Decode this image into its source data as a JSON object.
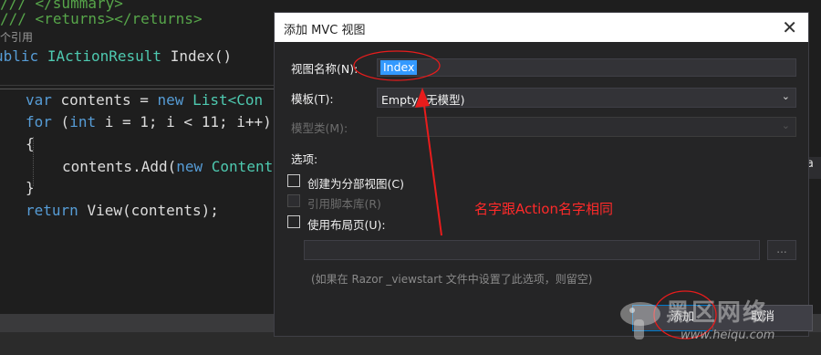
{
  "editor": {
    "line_summary": "/// </summary>",
    "line_returns_a": "///",
    "line_returns_b": "<returns></returns>",
    "ref_count": "个引用",
    "line_sig_a": "ublic",
    "line_sig_b": "IActionResult",
    "line_sig_c": "Index()",
    "line_var_a": "var",
    "line_var_b": "contents =",
    "line_var_c": "new",
    "line_var_d": "List<Con",
    "line_for_a": "for",
    "line_for_b": "(",
    "line_for_c": "int",
    "line_for_d": "i = 1; i < 11; i++)",
    "line_open": "{",
    "line_add_a": "contents.Add(",
    "line_add_b": "new",
    "line_add_c": "Content",
    "line_close": "}",
    "line_return_a": "return",
    "line_return_b": "View(contents);",
    "right_char": "a"
  },
  "dialog": {
    "title": "添加 MVC 视图",
    "close_glyph": "✕",
    "view_name_label": "视图名称(N):",
    "view_name_value": "Index",
    "template_label": "模板(T):",
    "template_value": "Empty (无模型)",
    "model_class_label": "模型类(M):",
    "model_class_value": "",
    "options_label": "选项:",
    "partial_view_label": "创建为分部视图(C)",
    "partial_view_checked": false,
    "script_lib_label": "引用脚本库(R)",
    "script_lib_checked": false,
    "layout_label": "使用布局页(U):",
    "layout_checked": false,
    "layout_path": "",
    "browse_label": "...",
    "note": "(如果在 Razor _viewstart 文件中设置了此选项，则留空)",
    "add_button": "添加",
    "cancel_button": "取消"
  },
  "annotation": {
    "text": "名字跟Action名字相同",
    "color": "#ff2a2a"
  },
  "watermark": {
    "brand": "黑区网络",
    "url": "www.heiqu.com"
  },
  "colors": {
    "keyword": "#569cd6",
    "type": "#4ec9b0",
    "comment": "#57a64a",
    "accent": "#007acc"
  }
}
